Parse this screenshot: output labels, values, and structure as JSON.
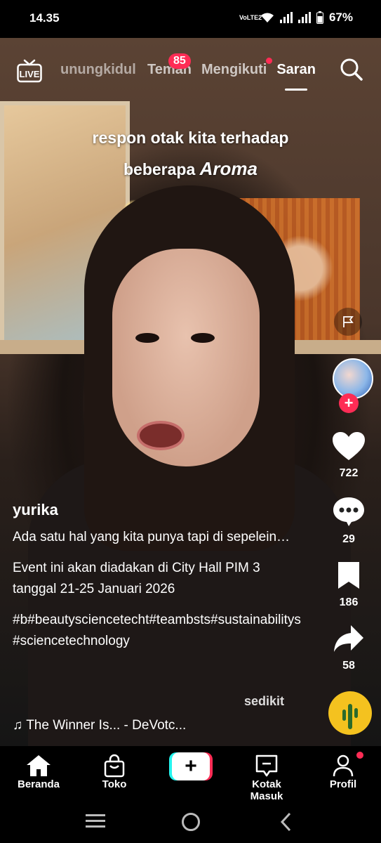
{
  "status_bar": {
    "time": "14.35",
    "carrier": "VoLTE2",
    "battery": "67%"
  },
  "top_nav": {
    "live_label": "LIVE",
    "tabs": [
      {
        "label": "unungkidul"
      },
      {
        "label": "Teman",
        "badge": "85"
      },
      {
        "label": "Mengikuti"
      },
      {
        "label": "Saran"
      }
    ]
  },
  "video": {
    "caption_line1": "respon otak kita terhadap",
    "caption_line2_prefix": "beberapa ",
    "caption_line2_emph": "Aroma"
  },
  "actions": {
    "likes": "722",
    "comments": "29",
    "bookmarks": "186",
    "shares": "58",
    "follow_symbol": "+"
  },
  "post": {
    "username": "yurika",
    "description_1": "Ada satu hal yang kita punya tapi di sepelein…",
    "description_2": "Event ini akan diadakan di City Hall PIM 3 tanggal 21-25 Januari 2026",
    "hashtags": "#b#beautysciencetecht#teambsts#sustainabilitys#sciencetechnology",
    "more_label": "sedikit",
    "music_note": "♫",
    "music": "The Winner Is... - DeVotc..."
  },
  "bottom_nav": {
    "home": "Beranda",
    "shop": "Toko",
    "create": "+",
    "inbox": "Kotak Masuk",
    "profile": "Profil"
  },
  "colors": {
    "accent": "#fe2c55",
    "cyan": "#25f4ee"
  }
}
